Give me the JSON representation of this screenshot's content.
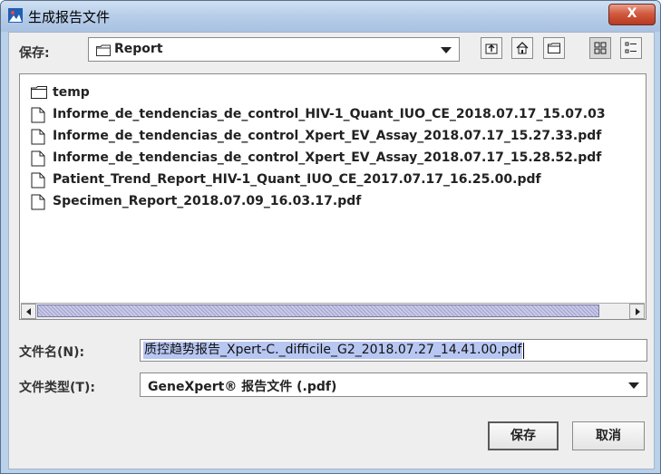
{
  "window": {
    "title": "生成报告文件",
    "close_glyph": "X"
  },
  "save_in": {
    "label": "保存:",
    "current_folder": "Report",
    "folder_icon": "folder-icon",
    "dropdown_icon": "chevron-down-icon"
  },
  "toolbar": [
    {
      "name": "up-one-level-button",
      "icon": "up-folder-icon"
    },
    {
      "name": "home-button",
      "icon": "home-icon"
    },
    {
      "name": "new-folder-button",
      "icon": "new-folder-icon"
    },
    {
      "name": "list-view-button",
      "icon": "list-view-icon",
      "selected": true
    },
    {
      "name": "details-view-button",
      "icon": "details-view-icon"
    }
  ],
  "files": [
    {
      "name": "temp",
      "type": "folder"
    },
    {
      "name": "Informe_de_tendencias_de_control_HIV-1_Quant_IUO_CE_2018.07.17_15.07.03",
      "type": "file"
    },
    {
      "name": "Informe_de_tendencias_de_control_Xpert_EV_Assay_2018.07.17_15.27.33.pdf",
      "type": "file"
    },
    {
      "name": "Informe_de_tendencias_de_control_Xpert_EV_Assay_2018.07.17_15.28.52.pdf",
      "type": "file"
    },
    {
      "name": "Patient_Trend_Report_HIV-1_Quant_IUO_CE_2017.07.17_16.25.00.pdf",
      "type": "file"
    },
    {
      "name": "Specimen_Report_2018.07.09_16.03.17.pdf",
      "type": "file"
    }
  ],
  "filename": {
    "label": "文件名(N):",
    "value": "质控趋势报告_Xpert-C._difficile_G2_2018.07.27_14.41.00.pdf"
  },
  "filetype": {
    "label": "文件类型(T):",
    "value": "GeneXpert® 报告文件 (.pdf)"
  },
  "buttons": {
    "save": "保存",
    "cancel": "取消"
  },
  "colors": {
    "title_gradient": "#b7cde8",
    "close_button": "#d25b3f",
    "selection": "#b8c7f2"
  }
}
